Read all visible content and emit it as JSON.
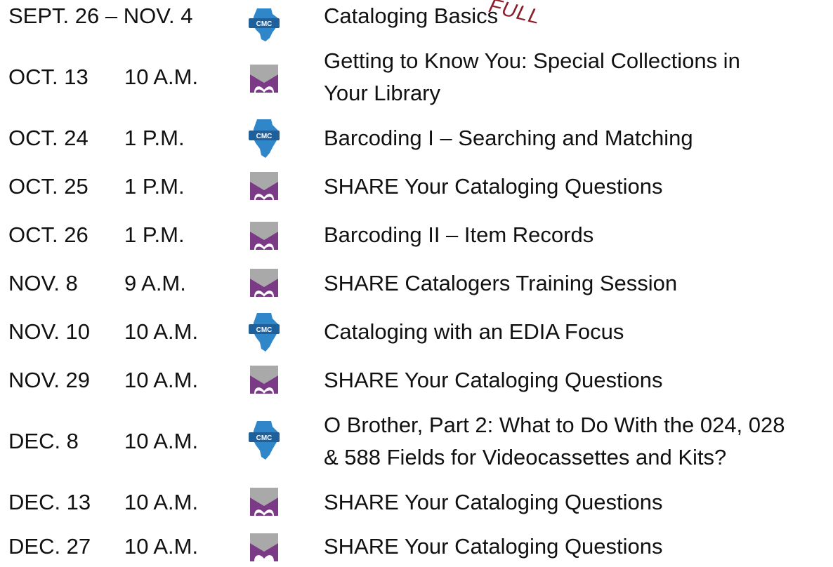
{
  "events": [
    {
      "date": "SEPT. 26 – NOV. 4",
      "time": "",
      "icon": "cmc-illinois-icon",
      "title_line1": "Cataloging Basics",
      "title_line2": "",
      "stamp": "FULL"
    },
    {
      "date": "OCT. 13",
      "time": "10 A.M.",
      "icon": "share-logo-icon",
      "title_line1": "Getting to Know You: Special Collections in",
      "title_line2": "Your Library"
    },
    {
      "date": "OCT. 24",
      "time": "1 P.M.",
      "icon": "cmc-illinois-icon",
      "title_line1": "Barcoding I – Searching and Matching",
      "title_line2": ""
    },
    {
      "date": "OCT. 25",
      "time": "1 P.M.",
      "icon": "share-logo-icon",
      "title_line1": "SHARE Your Cataloging Questions",
      "title_line2": ""
    },
    {
      "date": "OCT. 26",
      "time": "1 P.M.",
      "icon": "share-logo-icon",
      "title_line1": "Barcoding II – Item Records",
      "title_line2": ""
    },
    {
      "date": "NOV. 8",
      "time": "9 A.M.",
      "icon": "share-logo-icon",
      "title_line1": "SHARE Catalogers Training Session",
      "title_line2": ""
    },
    {
      "date": "NOV. 10",
      "time": "10 A.M.",
      "icon": "cmc-illinois-icon",
      "title_line1": "Cataloging with an EDIA Focus",
      "title_line2": ""
    },
    {
      "date": "NOV. 29",
      "time": "10 A.M.",
      "icon": "share-logo-icon",
      "title_line1": "SHARE Your Cataloging Questions",
      "title_line2": ""
    },
    {
      "date": "DEC. 8",
      "time": "10 A.M.",
      "icon": "cmc-illinois-icon",
      "title_line1": "O Brother, Part 2: What to Do With the 024, 028",
      "title_line2": "& 588 Fields for Videocassettes and Kits?"
    },
    {
      "date": "DEC. 13",
      "time": "10 A.M.",
      "icon": "share-logo-icon",
      "title_line1": "SHARE Your Cataloging Questions",
      "title_line2": ""
    },
    {
      "date": "DEC. 27",
      "time": "10 A.M.",
      "icon": "share-logo-icon",
      "title_line1": "SHARE Your Cataloging Questions",
      "title_line2": ""
    }
  ],
  "colors": {
    "text": "#111111",
    "cmc_blue": "#2f86c8",
    "cmc_dark": "#1f5f9a",
    "share_gray": "#a9a9a9",
    "share_purple": "#7a3a86",
    "stamp_red": "#8b1e2b"
  },
  "icon_labels": {
    "cmc": "CMC"
  }
}
